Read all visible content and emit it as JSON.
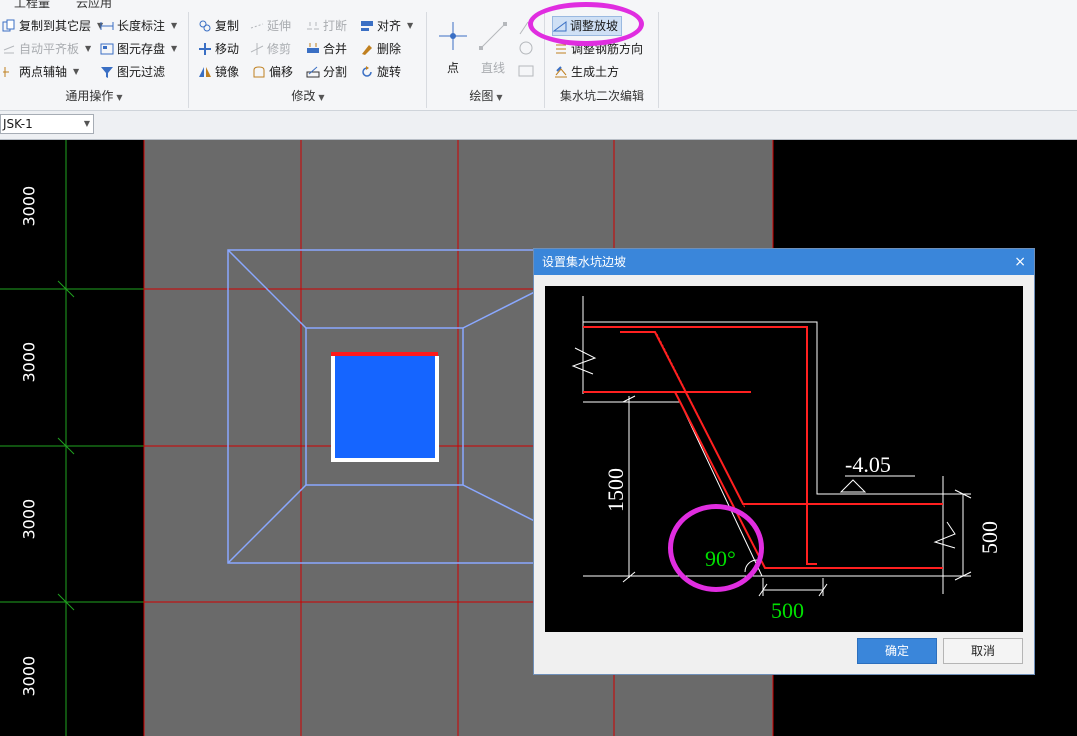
{
  "tabs": [
    "工程量",
    "云应用"
  ],
  "general": {
    "copy_to_floor": "复制到其它层",
    "auto_align_slab": "自动平齐板",
    "two_point_axis": "两点辅轴",
    "length_dim": "长度标注",
    "element_save": "图元存盘",
    "element_filter": "图元过滤",
    "group_label": "通用操作"
  },
  "modify": {
    "copy": "复制",
    "extend": "延伸",
    "break": "打断",
    "align": "对齐",
    "move": "移动",
    "trim": "修剪",
    "merge": "合并",
    "delete": "删除",
    "mirror": "镜像",
    "offset": "偏移",
    "split": "分割",
    "rotate": "旋转",
    "group_label": "修改"
  },
  "draw": {
    "point": "点",
    "line": "直线",
    "group_label": "绘图"
  },
  "sump_edit": {
    "adjust_slope": "调整放坡",
    "adjust_rebar_dir": "调整钢筋方向",
    "gen_earthwork": "生成土方",
    "group_label": "集水坑二次编辑"
  },
  "element_selector": {
    "value": "JSK-1"
  },
  "canvas": {
    "axis_dims": [
      "3000",
      "3000",
      "3000",
      "3000"
    ]
  },
  "dialog": {
    "title": "设置集水坑边坡",
    "close": "×",
    "ok": "确定",
    "cancel": "取消",
    "preview": {
      "elevation": "-4.05",
      "depth": "1500",
      "angle": "90°",
      "width": "500",
      "height": "500"
    }
  },
  "colors": {
    "accent_blue": "#3a86da",
    "highlight_magenta": "#e02de0",
    "grid_red": "#d00000",
    "pit_blue": "#1565ff",
    "slope_outline": "#8aa8ff",
    "preview_green": "#00e000"
  }
}
